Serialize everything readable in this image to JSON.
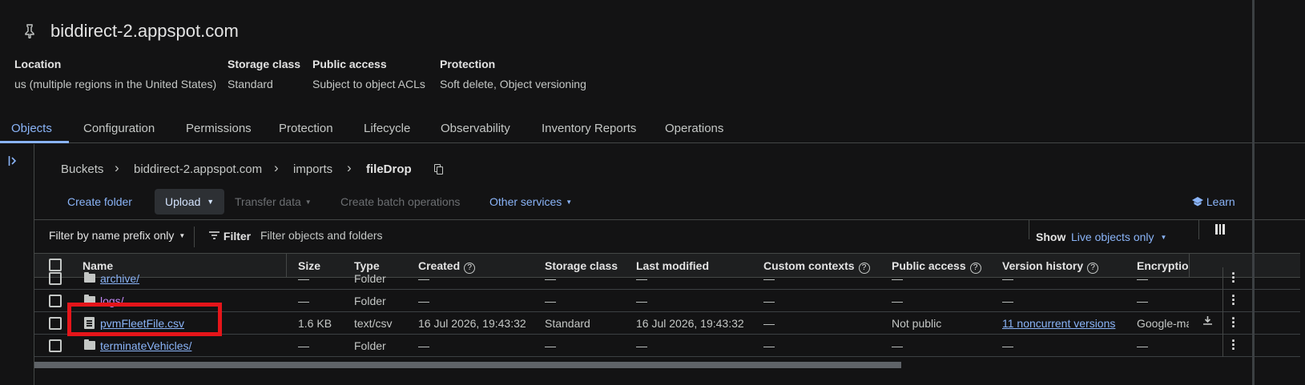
{
  "header": {
    "pin_icon": "push-pin-icon",
    "title": "biddirect-2.appspot.com"
  },
  "meta": [
    {
      "key": "Location",
      "value": "us (multiple regions in the United States)"
    },
    {
      "key": "Storage class",
      "value": "Standard"
    },
    {
      "key": "Public access",
      "value": "Subject to object ACLs"
    },
    {
      "key": "Protection",
      "value": "Soft delete, Object versioning"
    }
  ],
  "tabs": [
    "Objects",
    "Configuration",
    "Permissions",
    "Protection",
    "Lifecycle",
    "Observability",
    "Inventory Reports",
    "Operations"
  ],
  "breadcrumb": [
    "Buckets",
    "biddirect-2.appspot.com",
    "imports",
    "fileDrop"
  ],
  "breadcrumb_sep": "›",
  "actions": {
    "create_folder": "Create folder",
    "upload": "Upload",
    "transfer_data": "Transfer data",
    "create_batch": "Create batch operations",
    "other_services": "Other services",
    "learn": "Learn"
  },
  "filter": {
    "filter_by": "Filter by name prefix only",
    "filter_label": "Filter",
    "placeholder": "Filter objects and folders",
    "show_label": "Show",
    "show_value": "Live objects only"
  },
  "columns": [
    "Name",
    "Size",
    "Type",
    "Created",
    "Storage class",
    "Last modified",
    "Custom contexts",
    "Public access",
    "Version history",
    "Encryption"
  ],
  "rows": [
    {
      "name": "archive/",
      "size": "—",
      "type": "Folder",
      "created": "—",
      "storage": "—",
      "modified": "—",
      "contexts": "—",
      "public": "—",
      "versions": "—",
      "encryption": "—",
      "kind": "folder"
    },
    {
      "name": "logs/",
      "size": "—",
      "type": "Folder",
      "created": "—",
      "storage": "—",
      "modified": "—",
      "contexts": "—",
      "public": "—",
      "versions": "—",
      "encryption": "—",
      "kind": "folder"
    },
    {
      "name": "pvmFleetFile.csv",
      "size": "1.6 KB",
      "type": "text/csv",
      "created": "16 Jul 2026, 19:43:32",
      "storage": "Standard",
      "modified": "16 Jul 2026, 19:43:32",
      "contexts": "—",
      "public": "Not public",
      "versions": "11 noncurrent versions",
      "encryption": "Google-ma",
      "kind": "file"
    },
    {
      "name": "terminateVehicles/",
      "size": "—",
      "type": "Folder",
      "created": "—",
      "storage": "—",
      "modified": "—",
      "contexts": "—",
      "public": "—",
      "versions": "—",
      "encryption": "—",
      "kind": "folder"
    }
  ],
  "colors": {
    "accent": "#8ab4f8",
    "background": "#131314",
    "highlight": "#e5151a"
  }
}
